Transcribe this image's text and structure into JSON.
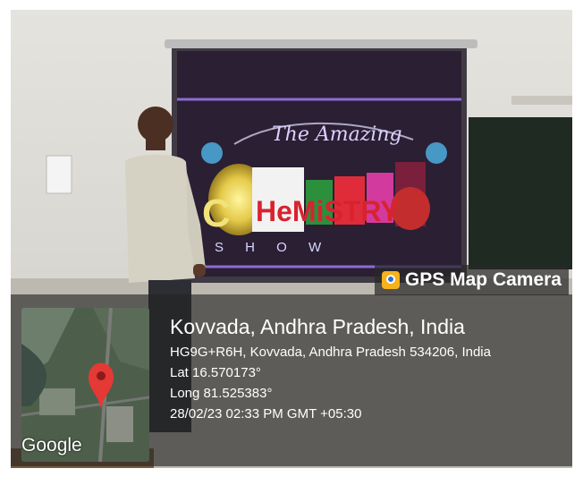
{
  "stamp": {
    "app_name": "GPS Map Camera",
    "location_title": "Kovvada, Andhra Pradesh, India",
    "address": "HG9G+R6H, Kovvada, Andhra Pradesh 534206, India",
    "latitude": "Lat 16.570173°",
    "longitude": "Long 81.525383°",
    "datetime": "28/02/23 02:33 PM GMT +05:30"
  },
  "map": {
    "attribution": "Google",
    "pin_color": "#e53935"
  },
  "slide": {
    "top_script": "The Amazing",
    "word_prefix": "C",
    "word_main": "HeMiSTRY",
    "subtitle": "S H O W"
  },
  "icons": [
    "gps-map-camera-icon",
    "map-pin-icon"
  ]
}
